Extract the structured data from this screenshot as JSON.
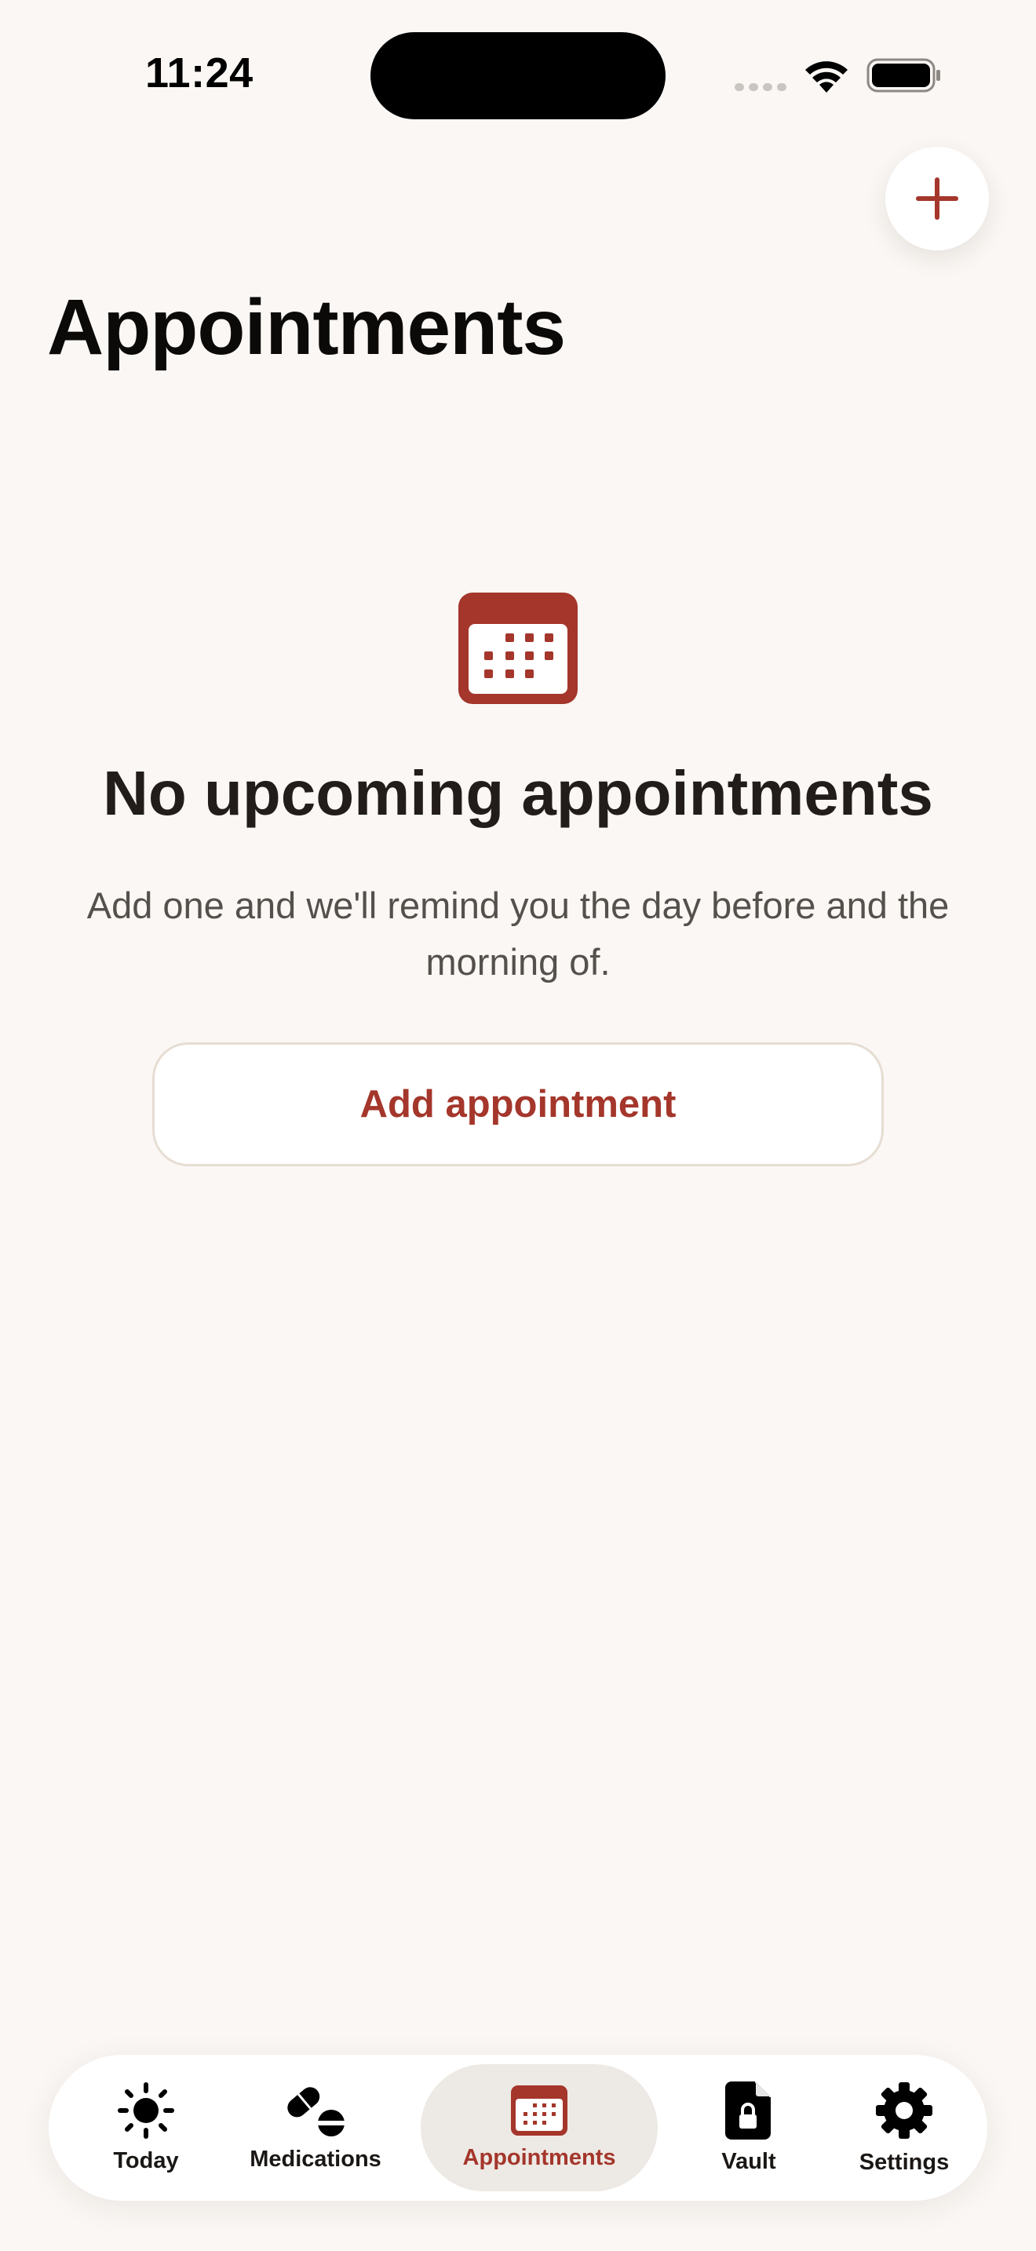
{
  "status_bar": {
    "time": "11:24"
  },
  "header": {
    "title": "Appointments",
    "add_icon": "plus-icon"
  },
  "empty_state": {
    "icon": "calendar-icon",
    "title": "No upcoming appointments",
    "body": "Add one and we'll remind you the day before and the morning of.",
    "button_label": "Add appointment"
  },
  "tabs": [
    {
      "label": "Today",
      "icon": "sun-icon",
      "active": false
    },
    {
      "label": "Medications",
      "icon": "pills-icon",
      "active": false
    },
    {
      "label": "Appointments",
      "icon": "calendar-icon",
      "active": true
    },
    {
      "label": "Vault",
      "icon": "locked-document-icon",
      "active": false
    },
    {
      "label": "Settings",
      "icon": "gear-icon",
      "active": false
    }
  ],
  "colors": {
    "accent": "#a4362b",
    "background": "#faf7f4",
    "active_tab_bg": "#ede9e4"
  }
}
